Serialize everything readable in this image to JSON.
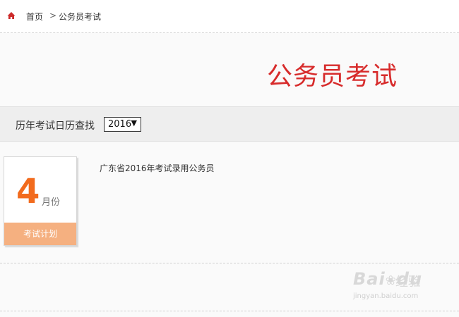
{
  "breadcrumb": {
    "home_label": "首页",
    "separator": ">",
    "current": "公务员考试"
  },
  "page": {
    "title": "公务员考试"
  },
  "filter": {
    "label": "历年考试日历查找",
    "year_selected": "2016"
  },
  "calendar": {
    "card": {
      "month_number": "4",
      "month_unit": "月份",
      "footer_label": "考试计划"
    },
    "entries": [
      {
        "text": "广东省2016年考试录用公务员"
      }
    ]
  },
  "watermark": {
    "logo_text": "Bai",
    "logo_text_2": "du",
    "product": "经验",
    "url": "jingyan.baidu.com"
  },
  "colors": {
    "title_red": "#d72b2b",
    "month_orange": "#f26b1d",
    "card_footer": "#f5b080",
    "home_icon": "#cc2a2a"
  },
  "icons": {
    "home": "home-icon",
    "dropdown": "triangle-down-icon"
  }
}
